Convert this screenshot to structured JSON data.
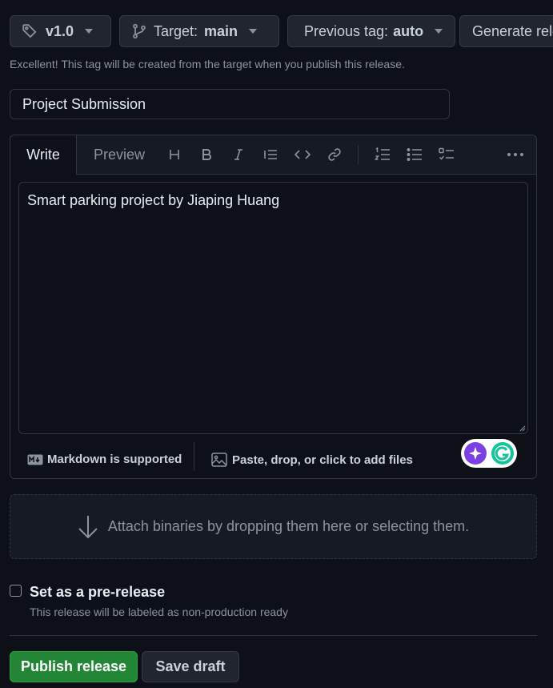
{
  "top_buttons": {
    "tag": "v1.0",
    "target_label": "Target:",
    "target_value": "main",
    "prev_tag_label": "Previous tag:",
    "prev_tag_value": "auto",
    "generate_label": "Generate release notes"
  },
  "hint_text": "Excellent! This tag will be created from the target when you publish this release.",
  "release_title": "Project Submission",
  "editor": {
    "tabs": [
      "Write",
      "Preview"
    ],
    "body_text": "Smart parking project by Jiaping Huang",
    "markdown_note": "Markdown is supported",
    "files_note": "Paste, drop, or click to add files",
    "toolbar_icons": [
      "heading-icon",
      "bold-icon",
      "italic-icon",
      "quote-icon",
      "code-icon",
      "link-icon",
      "numbered-list-icon",
      "bullet-list-icon",
      "task-list-icon",
      "more-icon"
    ]
  },
  "attach_text": "Attach binaries by dropping them here or selecting them.",
  "prerelease": {
    "label": "Set as a pre-release",
    "note": "This release will be labeled as non-production ready",
    "checked": false
  },
  "actions": {
    "publish": "Publish release",
    "draft": "Save draft"
  },
  "colors": {
    "background": "#0d1117",
    "publish_green": "#238636",
    "border": "#30363d",
    "muted_text": "#8b949e"
  }
}
